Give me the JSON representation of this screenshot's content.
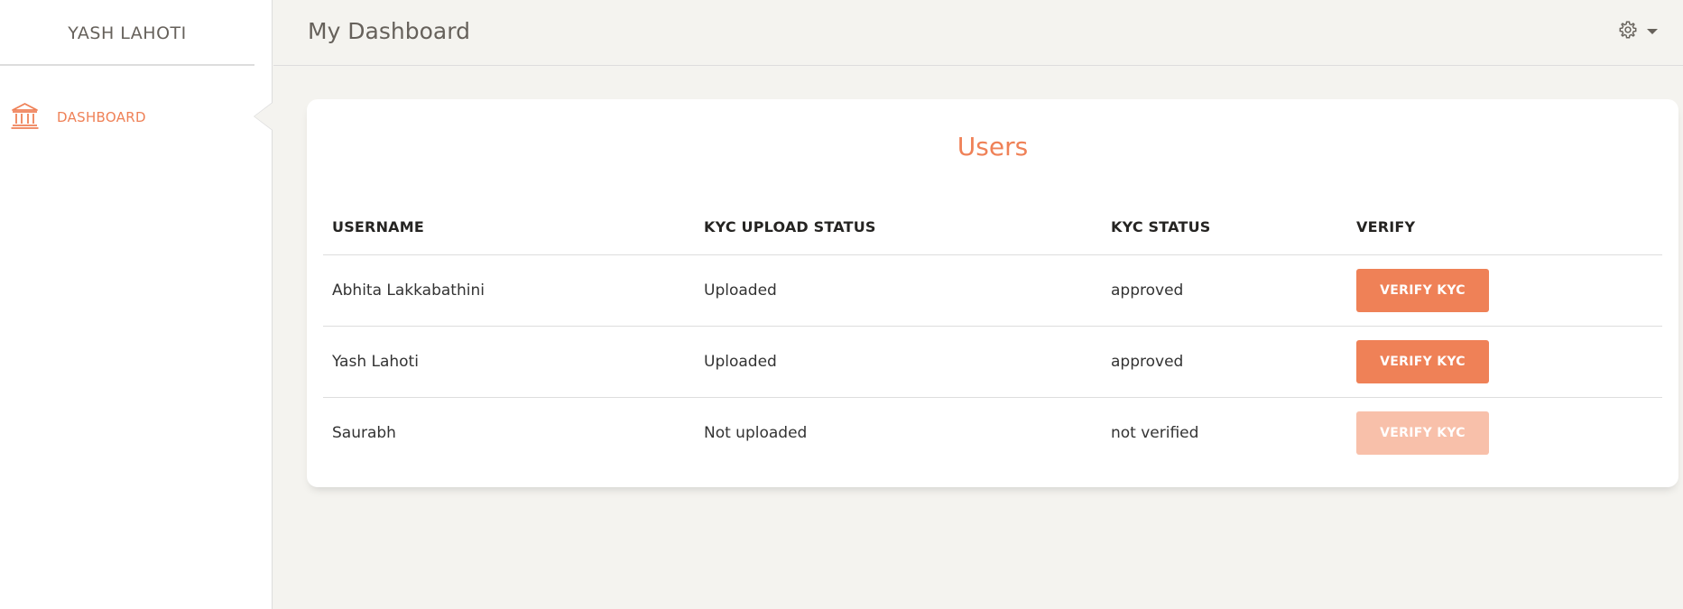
{
  "sidebar": {
    "brand": "YASH LAHOTI",
    "items": [
      {
        "label": "DASHBOARD",
        "icon": "bank-icon"
      }
    ]
  },
  "header": {
    "title": "My Dashboard",
    "settings_icon": "gear-icon"
  },
  "card": {
    "title": "Users",
    "columns": [
      "USERNAME",
      "KYC UPLOAD STATUS",
      "KYC STATUS",
      "VERIFY"
    ],
    "rows": [
      {
        "username": "Abhita Lakkabathini",
        "upload_status": "Uploaded",
        "kyc_status": "approved",
        "action": "VERIFY KYC",
        "enabled": true
      },
      {
        "username": "Yash Lahoti",
        "upload_status": "Uploaded",
        "kyc_status": "approved",
        "action": "VERIFY KYC",
        "enabled": true
      },
      {
        "username": "Saurabh",
        "upload_status": "Not uploaded",
        "kyc_status": "not verified",
        "action": "VERIFY KYC",
        "enabled": false
      }
    ]
  },
  "colors": {
    "accent": "#ef8157",
    "accent_disabled": "#f8c0aa",
    "background": "#f4f3ef"
  }
}
